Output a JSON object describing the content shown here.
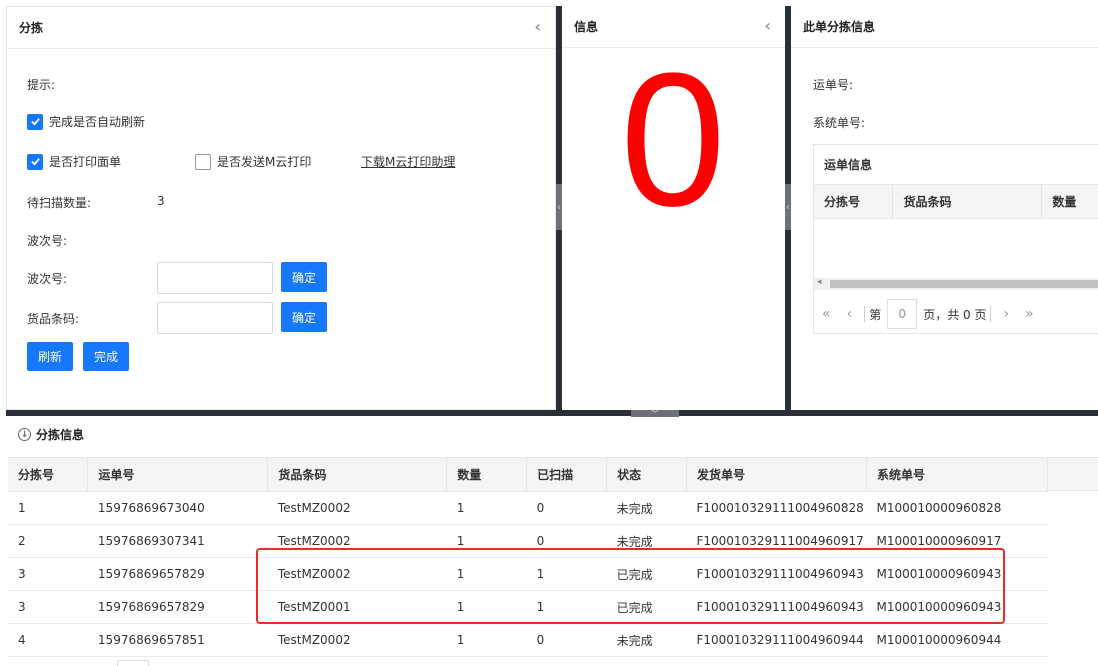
{
  "panel_left": {
    "title": "分拣",
    "hint_label": "提示:",
    "auto_refresh_label": "完成是否自动刷新",
    "print_sheet_label": "是否打印面单",
    "send_cloud_label": "是否发送M云打印",
    "download_link": "下载M云打印助理",
    "pending_label": "待扫描数量:",
    "pending_value": "3",
    "wave_label_a": "波次号:",
    "wave_label_b": "波次号:",
    "barcode_label": "货品条码:",
    "confirm_label_1": "确定",
    "confirm_label_2": "确定",
    "refresh_label": "刷新",
    "done_label": "完成"
  },
  "panel_info": {
    "title": "信息",
    "value": "0"
  },
  "panel_detail": {
    "title": "此单分拣信息",
    "waybill_label": "运单号:",
    "system_label": "系统单号:",
    "mini_table_title": "运单信息",
    "columns": [
      "分拣号",
      "货品条码",
      "数量"
    ],
    "pager_prefix": "第",
    "pager_page": "0",
    "pager_suffix": "页，共 0 页"
  },
  "bottom": {
    "title": "分拣信息",
    "columns": [
      "分拣号",
      "运单号",
      "货品条码",
      "数量",
      "已扫描",
      "状态",
      "发货单号",
      "系统单号"
    ],
    "rows": [
      [
        "1",
        "15976869673040",
        "TestMZ0002",
        "1",
        "0",
        "未完成",
        "F10001032911100496082​8",
        "M100010000960828"
      ],
      [
        "2",
        "15976869307341",
        "TestMZ0002",
        "1",
        "0",
        "未完成",
        "F100010329111004960917",
        "M100010000960917"
      ],
      [
        "3",
        "15976869657829",
        "TestMZ0002",
        "1",
        "1",
        "已完成",
        "F100010329111004960943",
        "M100010000960943"
      ],
      [
        "3",
        "15976869657829",
        "TestMZ0001",
        "1",
        "1",
        "已完成",
        "F100010329111004960943",
        "M100010000960943"
      ],
      [
        "4",
        "15976869657851",
        "TestMZ0002",
        "1",
        "0",
        "未完成",
        "F100010329111004960944",
        "M100010000960944"
      ]
    ]
  },
  "colors": {
    "accent": "#1677ff",
    "zero": "#ff0000",
    "highlight": "#ee2a2a",
    "splitter": "#2b2f36"
  }
}
